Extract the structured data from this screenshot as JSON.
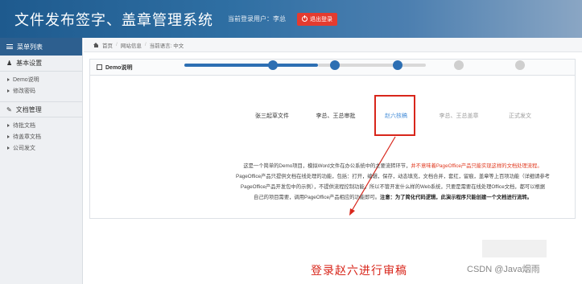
{
  "header": {
    "title": "文件发布签字、盖章管理系统",
    "login_user": "当前登录用户：李总",
    "logout_label": "退出登录"
  },
  "sidebar": {
    "menu_title": "菜单列表",
    "groups": [
      {
        "title": "基本设置",
        "items": [
          "Demo说明",
          "修改密码"
        ]
      },
      {
        "title": "文档管理",
        "items": [
          "待批文档",
          "待盖章文档",
          "公司发文"
        ]
      }
    ]
  },
  "breadcrumb": {
    "home": "首页",
    "items": [
      "网站信息",
      "当前语言: 中文"
    ]
  },
  "panel": {
    "title": "Demo说明"
  },
  "steps": [
    {
      "label": "张三起草文件",
      "status": "done"
    },
    {
      "label": "李总、王总审批",
      "status": "done"
    },
    {
      "label": "赵六核稿",
      "status": "current"
    },
    {
      "label": "李总、王总盖章",
      "status": "todo"
    },
    {
      "label": "正式发文",
      "status": "todo"
    }
  ],
  "description": {
    "line1_a": "这是一个简单的Demo项目，模拟Word文件在办公系统中的主要流转环节，",
    "line1_red": "并不意味着PageOffice产品只能实现这样的文档处理流程。",
    "line2": "PageOffice产品只提供文档在线处理的功能，包括：打开，编辑，保存，动态填充，文档合并，套红，留痕，盖章等上百项功能（详细请参考",
    "line3": "PageOffice产品开发包中的示例），不提供流程控制功能，所以不管开发什么样的Web系统，只要是需要在线处理Office文档，都可以根据",
    "line4_a": "自己的项目需要，调用PageOffice产品相应的功能即可。",
    "line4_bold": "注意：为了简化代码逻辑，此演示程序只能创建一个文档进行流转。"
  },
  "annotation": "登录赵六进行审稿",
  "watermark": "CSDN @Java烟雨",
  "colors": {
    "header_start": "#1e5a8e",
    "step_done": "#2d6fb3",
    "step_current_text": "#4a90d9",
    "highlight": "#d8261b",
    "logout": "#e43b2f"
  }
}
